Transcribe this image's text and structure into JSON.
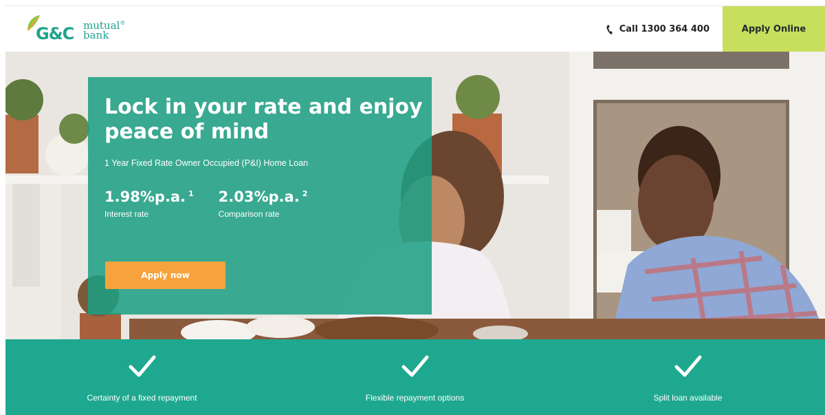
{
  "brand": {
    "logo_initials": "G&C",
    "logo_word1": "mutual",
    "logo_word2": "bank",
    "registered": "®",
    "colors": {
      "primary_teal": "#1fa38c",
      "lime": "#c7df5d",
      "orange": "#f7a33d"
    }
  },
  "header": {
    "call_icon": "phone-icon",
    "call_label": "Call 1300 364 400",
    "apply_online_label": "Apply Online"
  },
  "hero": {
    "title": "Lock in your rate and enjoy peace of mind",
    "subtitle": "1 Year Fixed Rate Owner Occupied (P&I) Home Loan",
    "rates": [
      {
        "value": "1.98%p.a.",
        "footnote": "1",
        "label": "Interest rate"
      },
      {
        "value": "2.03%p.a.",
        "footnote": "2",
        "label": "Comparison rate"
      }
    ],
    "cta_label": "Apply now"
  },
  "features": [
    {
      "icon": "checkmark-icon",
      "label": "Certainty of a fixed repayment"
    },
    {
      "icon": "checkmark-icon",
      "label": "Flexible repayment options"
    },
    {
      "icon": "checkmark-icon",
      "label": "Split loan available"
    }
  ]
}
